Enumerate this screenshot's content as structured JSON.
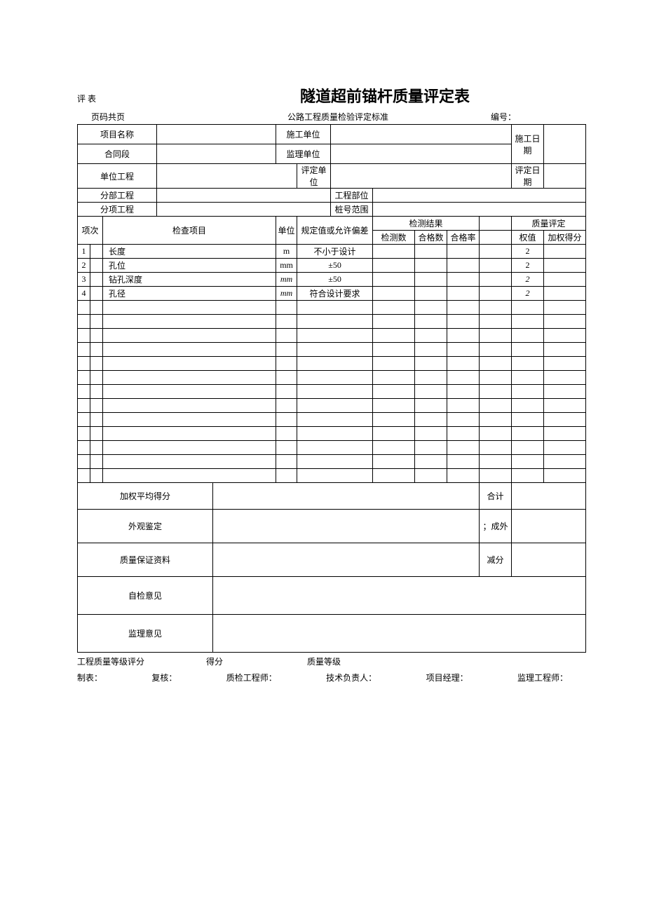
{
  "top_label": "评 表",
  "title": "隧道超前锚杆质量评定表",
  "sub": {
    "page_label": "页码共页",
    "standard": "公路工程质量检验评定标准",
    "number_label": "编号："
  },
  "info": {
    "project_name_label": "项目名称",
    "construction_unit_label": "施工单位",
    "construction_date_label": "施工日期",
    "contract_label": "合同段",
    "supervision_unit_label": "监理单位",
    "unit_project_label": "单位工程",
    "eval_unit_label": "评定单位",
    "eval_date_label": "评定日期",
    "sub_project_label": "分部工程",
    "project_part_label": "工程部位",
    "item_project_label": "分项工程",
    "stake_range_label": "桩号范围"
  },
  "th": {
    "seq": "项次",
    "inspect_item": "检查项目",
    "unit": "单位",
    "allowed": "规定值或允许偏差",
    "result": "检测结果",
    "quality": "质量评定",
    "detect_count": "检测数",
    "pass_count": "合格数",
    "pass_rate": "合格率",
    "weight": "权值",
    "weighted_score": "加权得分"
  },
  "rows": [
    {
      "seq": "1",
      "item": "长度",
      "unit": "m",
      "allowed": "不小于设计",
      "weight": "2",
      "italic": false
    },
    {
      "seq": "2",
      "item": "孔位",
      "unit": "mm",
      "allowed": "±50",
      "weight": "2",
      "italic": false
    },
    {
      "seq": "3",
      "item": "钻孔深度",
      "unit": "mm",
      "allowed": "±50",
      "weight": "2",
      "italic": true
    },
    {
      "seq": "4",
      "item": "孔径",
      "unit": "mm",
      "allowed": "符合设计要求",
      "weight": "2",
      "italic": true
    }
  ],
  "empty_rows": 13,
  "summary": {
    "weighted_avg_label": "加权平均得分",
    "total_label": "合计",
    "appearance_label": "外观鉴定",
    "appearance_right": "；成外",
    "qa_material_label": "质量保证资料",
    "deduct_label": "减分",
    "self_opinion_label": "自检意见",
    "supervision_opinion_label": "监理意见"
  },
  "footer1": {
    "grade_label": "工程质量等级评分",
    "score_label": "得分",
    "quality_grade_label": "质量等级"
  },
  "footer2": {
    "maker": "制表：",
    "reviewer": "复核：",
    "qc_engineer": "质检工程师：",
    "tech_lead": "技术负责人：",
    "pm": "项目经理：",
    "supervision_engineer": "监理工程师："
  }
}
